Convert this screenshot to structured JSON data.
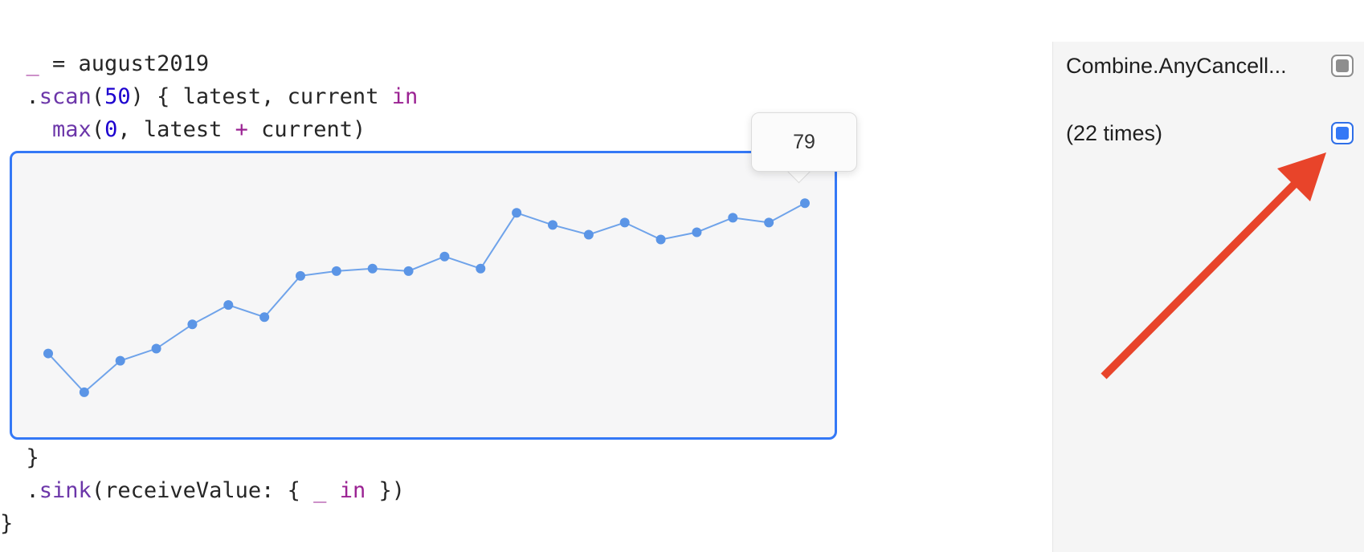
{
  "code": {
    "line1": {
      "underscore": "_",
      "rest": " = august2019"
    },
    "line2": {
      "dot": ".",
      "method": "scan",
      "open": "(",
      "arg": "50",
      "rest": ") { latest, current ",
      "keyword": "in"
    },
    "line3": {
      "func": "max",
      "open": "(",
      "zero": "0",
      "mid": ", latest ",
      "op": "+",
      "rest": " current)"
    },
    "line4": {
      "text": "}"
    },
    "line5": {
      "dot": ".",
      "method": "sink",
      "mid": "(receiveValue: { ",
      "underscore": "_",
      "space": " ",
      "keyword": "in",
      "rest": " })"
    },
    "line6": {
      "text": "}"
    }
  },
  "tooltip": {
    "value": "79"
  },
  "sidebar": {
    "result1": {
      "label": "Combine.AnyCancell..."
    },
    "result2": {
      "label": "(22 times)"
    }
  },
  "colors": {
    "accent": "#3478f6",
    "line": "#6fa3ea",
    "point": "#5b95e6",
    "arrow": "#e8442a"
  },
  "chart_data": {
    "type": "line",
    "x": [
      1,
      2,
      3,
      4,
      5,
      6,
      7,
      8,
      9,
      10,
      11,
      12,
      13,
      14,
      15,
      16,
      17,
      18,
      19,
      20,
      21,
      22
    ],
    "values": [
      20,
      12,
      18.5,
      21,
      26,
      30,
      27.5,
      36,
      37,
      37.5,
      37,
      40,
      37.5,
      49,
      46.5,
      44.5,
      47,
      43.5,
      45,
      48,
      47,
      51
    ],
    "ylim": [
      0,
      79
    ],
    "highlighted_index": 21
  }
}
